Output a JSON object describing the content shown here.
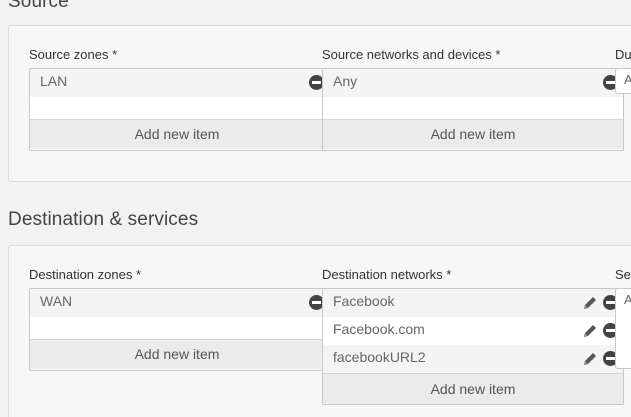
{
  "source": {
    "title": "Source",
    "zones": {
      "label": "Source zones *",
      "items": [
        "LAN"
      ],
      "add_label": "Add new item"
    },
    "networks": {
      "label": "Source networks and devices *",
      "items": [
        "Any"
      ],
      "add_label": "Add new item"
    },
    "third_label": "Du",
    "third_value": "A"
  },
  "destination": {
    "title": "Destination & services",
    "zones": {
      "label": "Destination zones *",
      "items": [
        "WAN"
      ],
      "add_label": "Add new item"
    },
    "networks": {
      "label": "Destination networks *",
      "items": [
        "Facebook",
        "Facebook.com",
        "facebookURL2"
      ],
      "add_label": "Add new item"
    },
    "third_label": "Se",
    "third_value": "A"
  }
}
